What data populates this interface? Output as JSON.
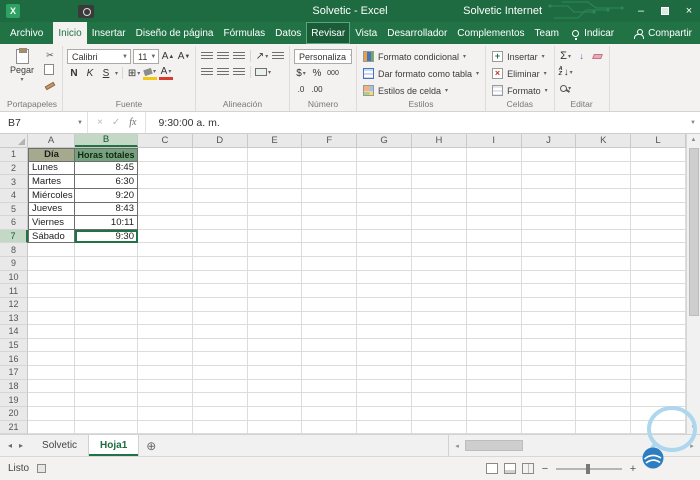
{
  "colors": {
    "accent_green": "#217346",
    "title_bar_green": "#1e6a41",
    "table_header_a_fill": "#a5a98d",
    "table_header_b_fill": "#74a17e",
    "selection_border": "#217346",
    "logo_blue": "#2d7ec0",
    "logo_bubble_blue": "#aed7ee"
  },
  "title_bar": {
    "title": "Solvetic  -  Excel",
    "right_text": "Solvetic Internet"
  },
  "tabs": {
    "file": "Archivo",
    "items": [
      "Inicio",
      "Insertar",
      "Diseño de página",
      "Fórmulas",
      "Datos",
      "Revisar",
      "Vista",
      "Desarrollador",
      "Complementos",
      "Team"
    ],
    "active": "Inicio",
    "highlighted": "Revisar",
    "tell_me": "Indicar",
    "share": "Compartir"
  },
  "ribbon": {
    "clipboard": {
      "label": "Portapapeles",
      "paste": "Pegar"
    },
    "font": {
      "label": "Fuente",
      "family": "Calibri",
      "size": "11",
      "bold": "N",
      "italic": "K",
      "underline": "S",
      "grow": "A",
      "shrink": "A",
      "color_icon": "A"
    },
    "alignment": {
      "label": "Alineación"
    },
    "number": {
      "label": "Número",
      "format": "Personaliza",
      "currency": "$",
      "percent": "%",
      "thousands": "000",
      "dec1": ".0",
      "dec2": ".00"
    },
    "styles": {
      "label": "Estilos",
      "conditional": "Formato condicional",
      "format_table": "Dar formato como tabla",
      "cell_styles": "Estilos de celda"
    },
    "cells": {
      "label": "Celdas",
      "insert": "Insertar",
      "delete": "Eliminar",
      "format": "Formato"
    },
    "editing": {
      "label": "Editar",
      "autosum": "Σ"
    }
  },
  "formula_bar": {
    "name_box": "B7",
    "fx": "fx",
    "value": "9:30:00 a. m."
  },
  "grid": {
    "columns": [
      "A",
      "B",
      "C",
      "D",
      "E",
      "F",
      "G",
      "H",
      "I",
      "J",
      "K",
      "L"
    ],
    "row_count": 21,
    "selected": {
      "col": "B",
      "row": 7
    },
    "cells": [
      {
        "col": "A",
        "row": 1,
        "text": "Día",
        "cls": "hdra"
      },
      {
        "col": "B",
        "row": 1,
        "text": "Horas totales",
        "cls": "hdrb"
      },
      {
        "col": "A",
        "row": 2,
        "text": "Lunes",
        "cls": "day"
      },
      {
        "col": "B",
        "row": 2,
        "text": "8:45",
        "cls": "time"
      },
      {
        "col": "A",
        "row": 3,
        "text": "Martes",
        "cls": "day"
      },
      {
        "col": "B",
        "row": 3,
        "text": "6:30",
        "cls": "time"
      },
      {
        "col": "A",
        "row": 4,
        "text": "Miércoles",
        "cls": "day"
      },
      {
        "col": "B",
        "row": 4,
        "text": "9:20",
        "cls": "time"
      },
      {
        "col": "A",
        "row": 5,
        "text": "Jueves",
        "cls": "day"
      },
      {
        "col": "B",
        "row": 5,
        "text": "8:43",
        "cls": "time"
      },
      {
        "col": "A",
        "row": 6,
        "text": "Viernes",
        "cls": "day"
      },
      {
        "col": "B",
        "row": 6,
        "text": "10:11",
        "cls": "time"
      },
      {
        "col": "A",
        "row": 7,
        "text": "Sábado",
        "cls": "day"
      },
      {
        "col": "B",
        "row": 7,
        "text": "9:30",
        "cls": "time"
      }
    ]
  },
  "sheet_bar": {
    "tabs": [
      "Solvetic",
      "Hoja1"
    ],
    "active": "Hoja1"
  },
  "status_bar": {
    "ready": "Listo"
  }
}
